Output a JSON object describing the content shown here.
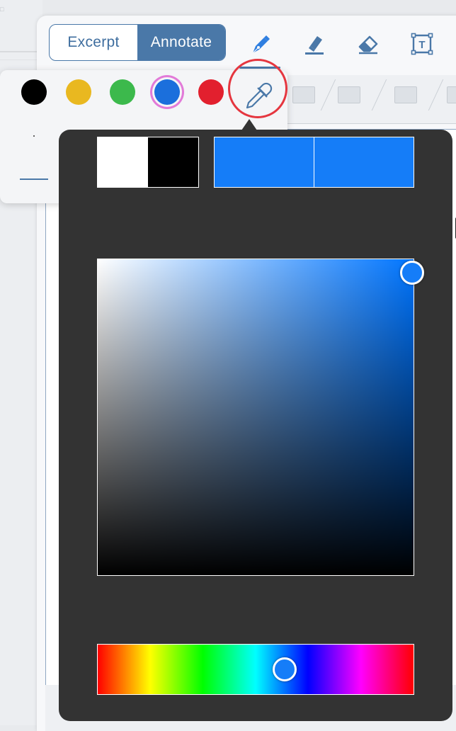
{
  "segmented": {
    "excerpt_label": "Excerpt",
    "annotate_label": "Annotate",
    "active": "Annotate"
  },
  "tools": [
    {
      "name": "pen-icon",
      "selected": true
    },
    {
      "name": "highlighter-icon",
      "selected": false
    },
    {
      "name": "eraser-icon",
      "selected": false
    },
    {
      "name": "text-box-icon",
      "selected": false
    }
  ],
  "text_tool_glyph": "T",
  "palette": {
    "swatches": [
      {
        "name": "black",
        "color": "#000000",
        "selected": false
      },
      {
        "name": "yellow",
        "color": "#e9b820",
        "selected": false
      },
      {
        "name": "green",
        "color": "#3cb94c",
        "selected": false
      },
      {
        "name": "blue",
        "color": "#1b6fdc",
        "selected": true
      },
      {
        "name": "red",
        "color": "#e2202e",
        "selected": false
      }
    ],
    "eyedropper_icon": "eyedropper-icon",
    "highlight_ring_color": "#e5363f"
  },
  "picker": {
    "background": "#333333",
    "previous_colors": [
      "#ffffff",
      "#000000"
    ],
    "current_colors": [
      "#157df8",
      "#157df8"
    ],
    "selected_color": "#157df8",
    "saturation": 1.0,
    "brightness": 0.97,
    "hue_fraction": 0.59
  },
  "accent_color": "#4a78a8"
}
